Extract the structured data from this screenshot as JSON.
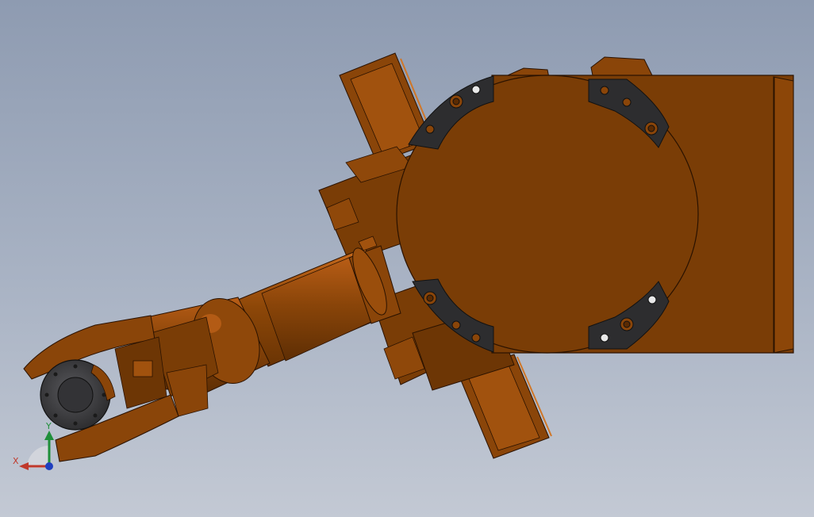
{
  "viewport": {
    "background_top": "#8e9bb1",
    "background_bottom": "#c3c9d4"
  },
  "model": {
    "body_color": "#7a3d06",
    "edge_color": "#2a1200",
    "highlight_color": "#c2641a",
    "plate_color": "#2d2d2f",
    "flange_color": "#3b3b3d"
  },
  "triad": {
    "x_label": "X",
    "y_label": "Y",
    "x_color": "#c0392b",
    "y_color": "#1f8f3a",
    "z_color": "#1f3fbf"
  }
}
